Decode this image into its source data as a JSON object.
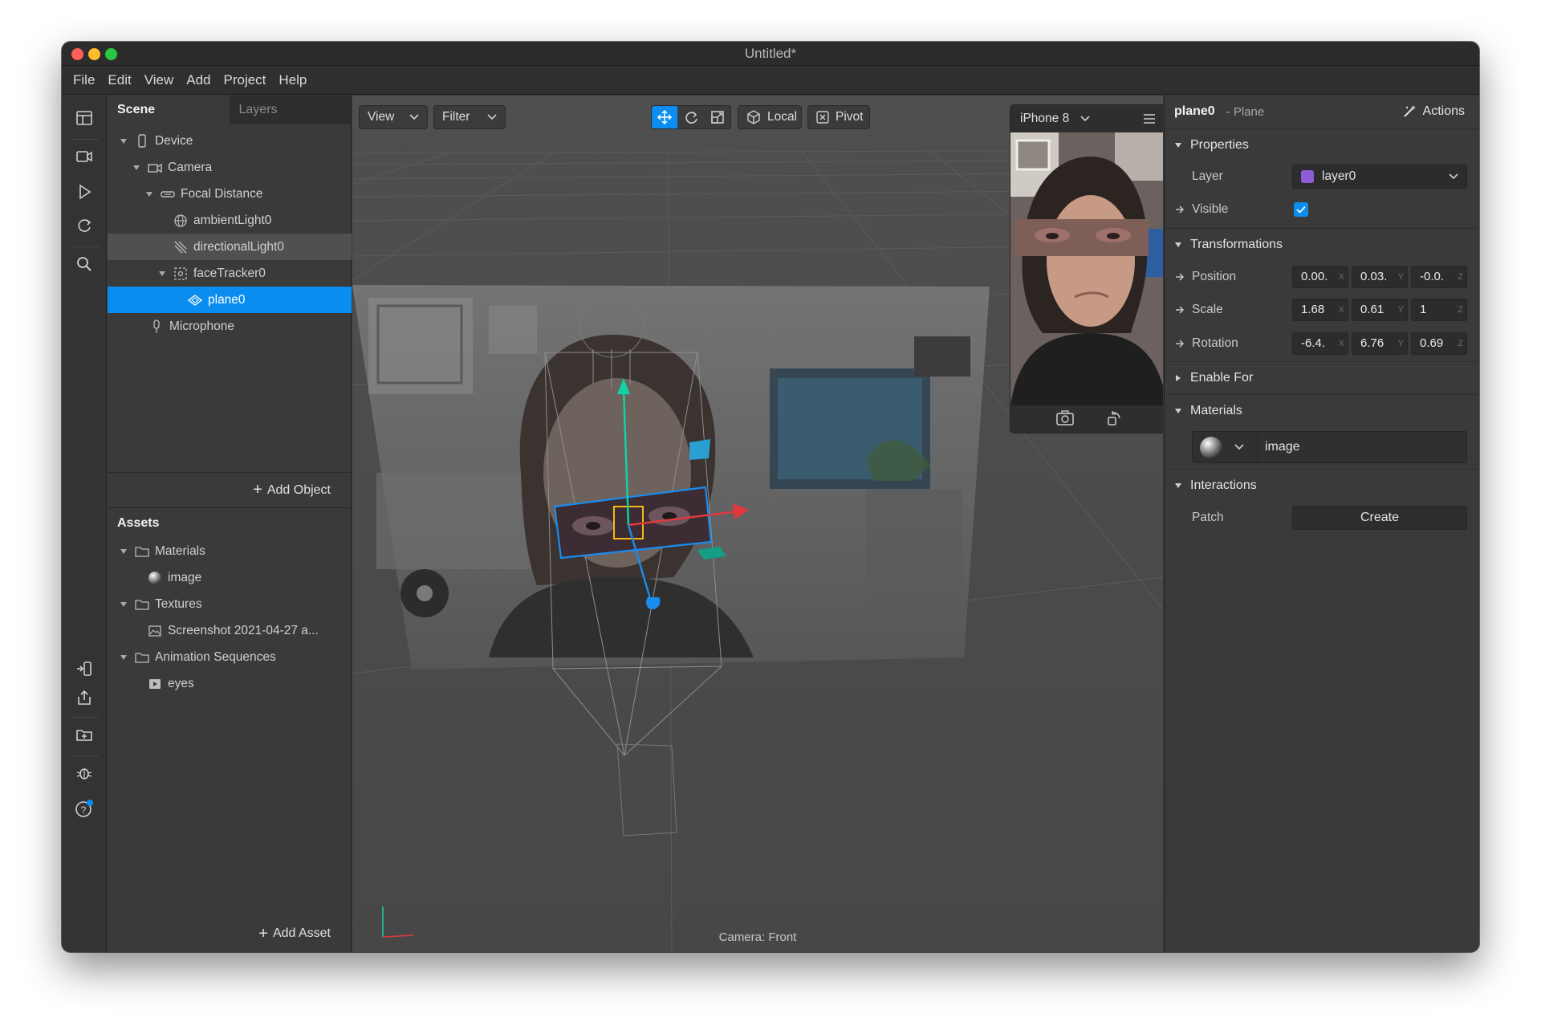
{
  "window": {
    "title": "Untitled*"
  },
  "menu": [
    "File",
    "Edit",
    "View",
    "Add",
    "Project",
    "Help"
  ],
  "scene_panel": {
    "tabs": [
      "Scene",
      "Layers"
    ],
    "tree": [
      {
        "label": "Device"
      },
      {
        "label": "Camera"
      },
      {
        "label": "Focal Distance"
      },
      {
        "label": "ambientLight0"
      },
      {
        "label": "directionalLight0"
      },
      {
        "label": "faceTracker0"
      },
      {
        "label": "plane0"
      },
      {
        "label": "Microphone"
      }
    ],
    "add_object": "Add Object"
  },
  "assets_panel": {
    "title": "Assets",
    "tree": [
      {
        "label": "Materials"
      },
      {
        "label": "image"
      },
      {
        "label": "Textures"
      },
      {
        "label": "Screenshot 2021-04-27 a..."
      },
      {
        "label": "Animation Sequences"
      },
      {
        "label": "eyes"
      }
    ],
    "add_asset": "Add Asset"
  },
  "viewport": {
    "view_label": "View",
    "filter_label": "Filter",
    "local_label": "Local",
    "pivot_label": "Pivot",
    "status": "Camera: Front"
  },
  "preview": {
    "device": "iPhone 8"
  },
  "inspector": {
    "object_name": "plane0",
    "object_type": "- Plane",
    "actions": "Actions",
    "sections": {
      "properties": "Properties",
      "transformations": "Transformations",
      "enable_for": "Enable For",
      "materials": "Materials",
      "interactions": "Interactions"
    },
    "layer": {
      "label": "Layer",
      "value": "layer0",
      "color": "#8e5cd6"
    },
    "visible": {
      "label": "Visible"
    },
    "position": {
      "label": "Position",
      "x": "0.00.",
      "y": "0.03.",
      "z": "-0.0."
    },
    "scale": {
      "label": "Scale",
      "x": "1.68",
      "y": "0.61",
      "z": "1"
    },
    "rotation": {
      "label": "Rotation",
      "x": "-6.4.",
      "y": "6.76",
      "z": "0.69"
    },
    "axis_labels": {
      "x": "X",
      "y": "Y",
      "z": "Z"
    },
    "material_name": "image",
    "patch": {
      "label": "Patch",
      "button": "Create"
    }
  },
  "colors": {
    "accent": "#0b8df0",
    "gizmo_x": "#e0393e",
    "gizmo_y": "#10d3a6",
    "gizmo_z": "#1a8cf0",
    "selection": "#f5b914"
  }
}
